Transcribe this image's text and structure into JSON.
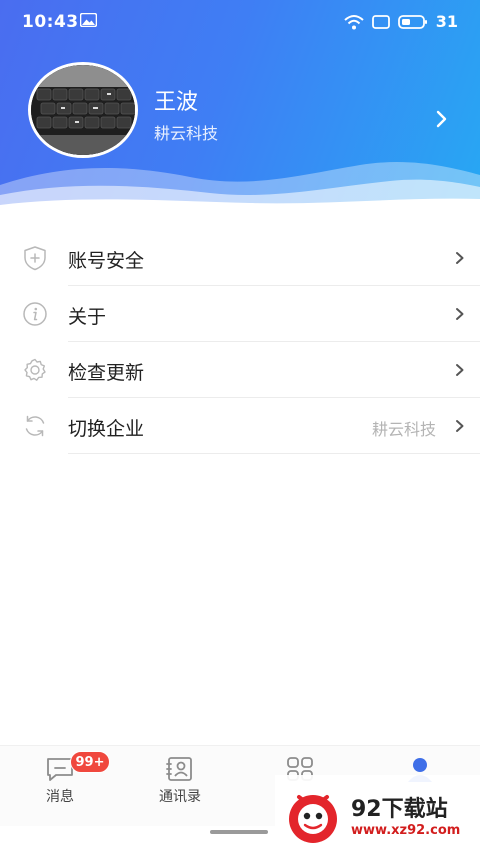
{
  "status_bar": {
    "time": "10:43",
    "battery": "31"
  },
  "profile": {
    "name": "王波",
    "company": "耕云科技"
  },
  "menu": [
    {
      "label": "账号安全",
      "icon": "shield-plus-icon"
    },
    {
      "label": "关于",
      "icon": "info-icon"
    },
    {
      "label": "检查更新",
      "icon": "gear-icon"
    },
    {
      "label": "切换企业",
      "icon": "sync-icon",
      "value": "耕云科技"
    }
  ],
  "tabbar": {
    "messages": {
      "label": "消息",
      "badge": "99+"
    },
    "contacts": {
      "label": "通讯录"
    },
    "apps": {
      "label": ""
    },
    "me": {
      "label": ""
    }
  },
  "watermark": {
    "title": "92下载站",
    "url": "www.xz92.com"
  },
  "colors": {
    "header_start": "#4a6df0",
    "header_end": "#27a8f3",
    "badge": "#f0483e",
    "active_tab": "#3f6fe8"
  }
}
